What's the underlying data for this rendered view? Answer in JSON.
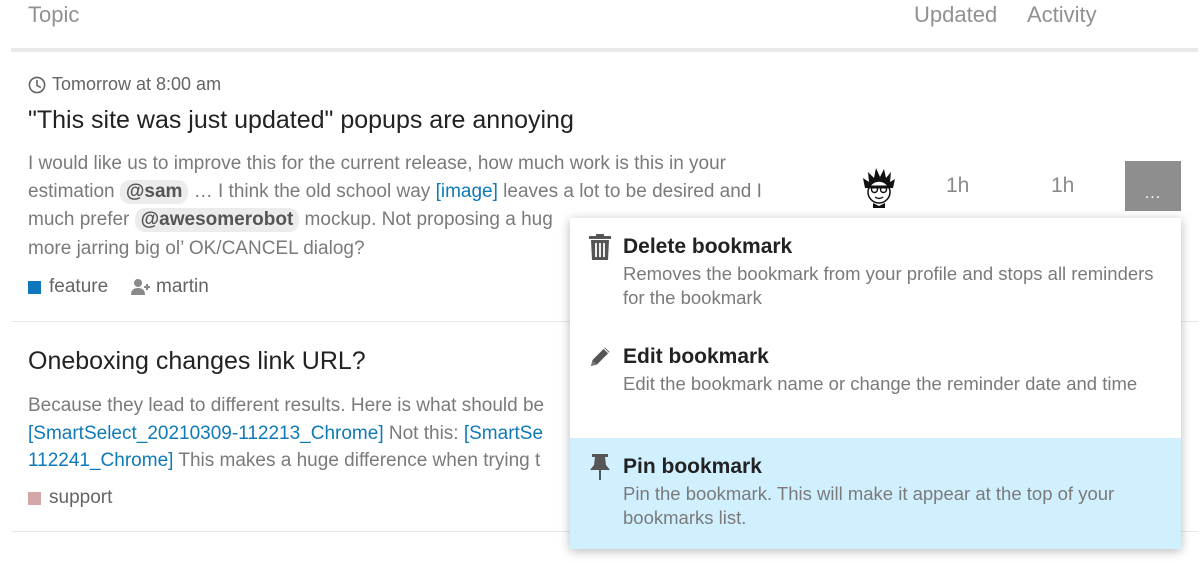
{
  "header": {
    "topic": "Topic",
    "updated": "Updated",
    "activity": "Activity"
  },
  "topic1": {
    "reminder": "Tomorrow at 8:00 am",
    "title": "\"This site was just updated\" popups are annoying",
    "excerpt": {
      "l1": "I would like us to improve this for the current release, how much work is this in your",
      "l2a": "estimation ",
      "mention1": "@sam",
      "l2b": " … I think the old school way ",
      "image_link": "[image]",
      "l2c": " leaves a lot to be desired and I",
      "l3a": "much prefer ",
      "mention2": "@awesomerobot",
      "l3b": " mockup. Not proposing a hug",
      "l4": "more jarring big ol’ OK/CANCEL dialog?"
    },
    "category": "feature",
    "category_color": "#0e76bd",
    "assignee": "martin",
    "updated": "1h",
    "activity": "1h",
    "more_button": "..."
  },
  "topic2": {
    "title": "Oneboxing changes link URL?",
    "excerpt": {
      "l1": "Because they lead to different results. Here is what should be",
      "l2a": "[SmartSelect_20210309-112213_Chrome]",
      "l2b": " Not this: ",
      "l2c": "[SmartSe",
      "l3a": "112241_Chrome]",
      "l3b": " This makes a huge difference when trying t"
    },
    "category": "support",
    "category_color": "#d5a6a8"
  },
  "menu": {
    "items": [
      {
        "label": "Delete bookmark",
        "icon": "trash-icon",
        "desc": "Removes the bookmark from your profile and stops all reminders for the bookmark"
      },
      {
        "label": "Edit bookmark",
        "icon": "pencil-icon",
        "desc": "Edit the bookmark name or change the reminder date and time"
      },
      {
        "label": "Pin bookmark",
        "icon": "thumbtack-icon",
        "desc": "Pin the bookmark. This will make it appear at the top of your bookmarks list."
      }
    ]
  },
  "colors": {
    "highlight": "#d1f0ff",
    "link": "#0f7ab8",
    "more_button_bg": "#8e8e8e"
  }
}
